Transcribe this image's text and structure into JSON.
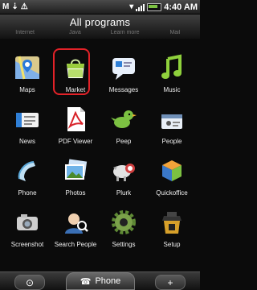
{
  "status": {
    "left_icons": [
      "gmail-icon",
      "usb-icon",
      "warning-icon"
    ],
    "time": "4:40 AM"
  },
  "header": {
    "title": "All programs",
    "prev_row": [
      "Internet",
      "Java",
      "Learn more",
      "Mail"
    ]
  },
  "apps": [
    {
      "label": "Maps",
      "icon": "maps-icon"
    },
    {
      "label": "Market",
      "icon": "market-icon",
      "selected": true
    },
    {
      "label": "Messages",
      "icon": "messages-icon"
    },
    {
      "label": "Music",
      "icon": "music-icon"
    },
    {
      "label": "News",
      "icon": "news-icon"
    },
    {
      "label": "PDF Viewer",
      "icon": "pdf-icon"
    },
    {
      "label": "Peep",
      "icon": "peep-icon"
    },
    {
      "label": "People",
      "icon": "people-icon"
    },
    {
      "label": "Phone",
      "icon": "phone-icon"
    },
    {
      "label": "Photos",
      "icon": "photos-icon"
    },
    {
      "label": "Plurk",
      "icon": "plurk-icon"
    },
    {
      "label": "Quickoffice",
      "icon": "quickoffice-icon"
    },
    {
      "label": "Screenshot",
      "icon": "screenshot-icon"
    },
    {
      "label": "Search People",
      "icon": "search-people-icon"
    },
    {
      "label": "Settings",
      "icon": "settings-icon"
    },
    {
      "label": "Setup",
      "icon": "setup-icon"
    }
  ],
  "dock": {
    "phone_label": "Phone",
    "left_icon": "home-icon",
    "right_icon": "add-icon"
  }
}
